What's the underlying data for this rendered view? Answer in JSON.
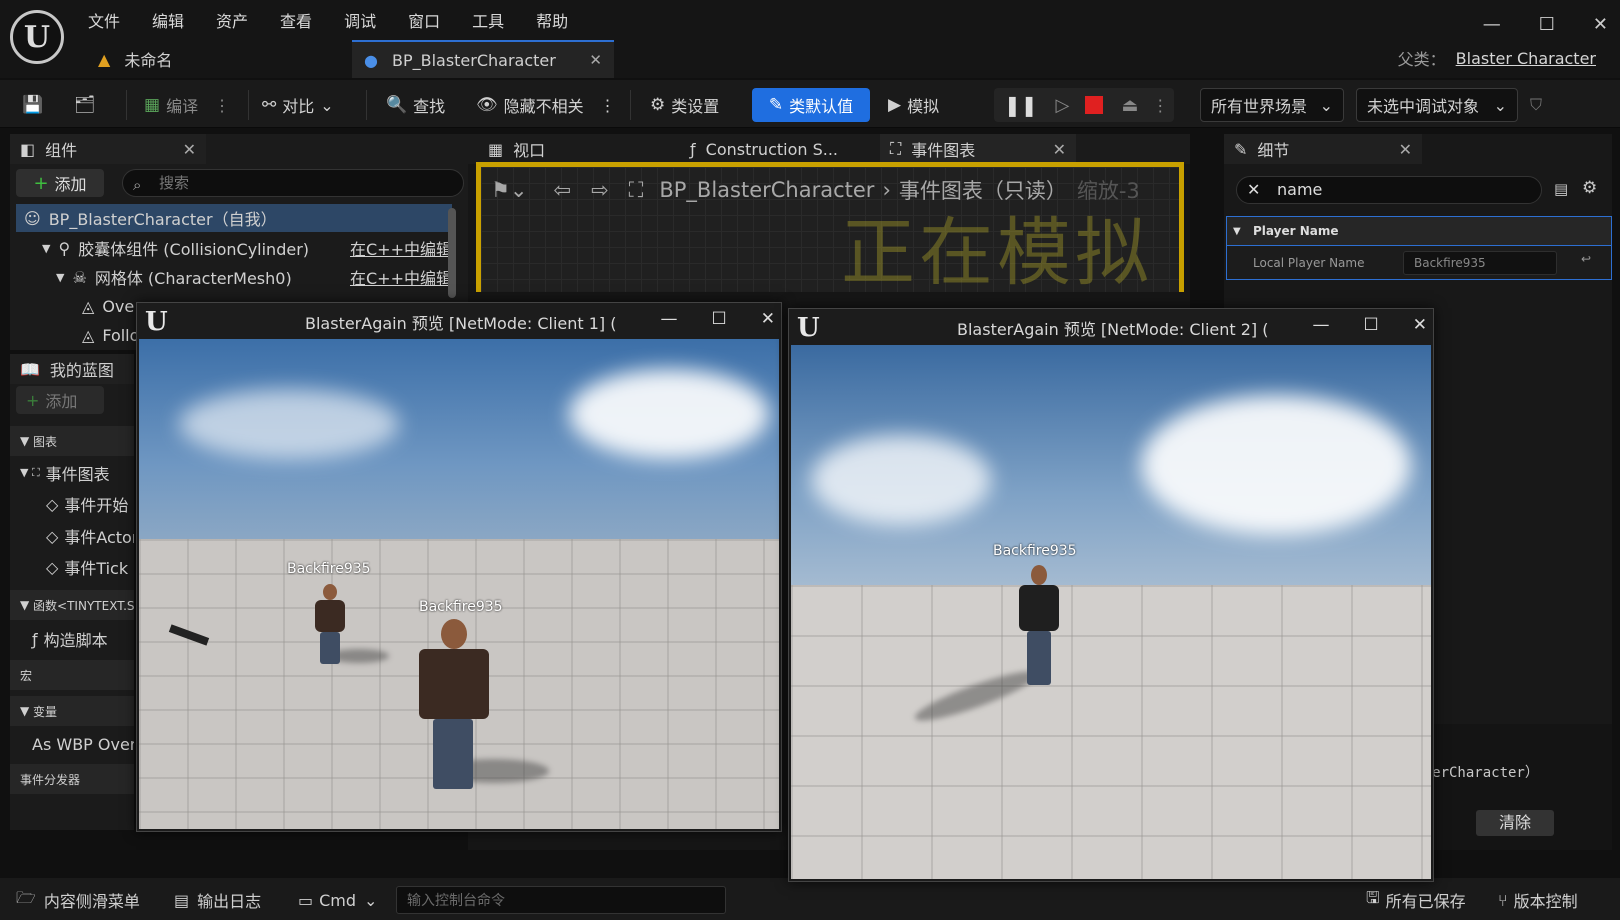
{
  "titlebar": {
    "menu": [
      "文件",
      "编辑",
      "资产",
      "查看",
      "调试",
      "窗口",
      "工具",
      "帮助"
    ],
    "tabs": [
      {
        "label": "未命名"
      },
      {
        "label": "BP_BlasterCharacter"
      }
    ],
    "parent_label": "父类：",
    "parent_value": "Blaster Character"
  },
  "toolbar": {
    "compile": "编译",
    "diff": "对比",
    "find": "查找",
    "hide_unrelated": "隐藏不相关",
    "class_settings": "类设置",
    "class_defaults": "类默认值",
    "simulate": "模拟",
    "world_dropdown": "所有世界场景",
    "debug_dropdown": "未选中调试对象"
  },
  "components": {
    "title": "组件",
    "add": "添加",
    "search_placeholder": "搜索",
    "tree": [
      {
        "label": "BP_BlasterCharacter（自我）",
        "edit": ""
      },
      {
        "label": "胶囊体组件 (CollisionCylinder)",
        "edit": "在C++中编辑"
      },
      {
        "label": "网格体 (CharacterMesh0)",
        "edit": "在C++中编辑"
      },
      {
        "label": "Ove",
        "edit": ""
      },
      {
        "label": "Follo",
        "edit": ""
      }
    ]
  },
  "my_blueprint": {
    "title": "我的蓝图",
    "add": "添加",
    "rows": [
      {
        "label": "图表"
      },
      {
        "label": "事件图表"
      },
      {
        "label": "事件开始"
      },
      {
        "label": "事件Actor"
      },
      {
        "label": "事件Tick"
      },
      {
        "label": "函数<TINYTEXT.S"
      },
      {
        "label": "构造脚本"
      },
      {
        "label": "宏"
      },
      {
        "label": "变量"
      },
      {
        "label": "As WBP Over"
      },
      {
        "label": "事件分发器"
      }
    ]
  },
  "center": {
    "tabs": [
      "视口",
      "Construction S...",
      "事件图表"
    ],
    "breadcrumb_bp": "BP_BlasterCharacter",
    "breadcrumb_graph": "事件图表（只读）",
    "zoom": "缩放-3",
    "watermark": "正在模拟"
  },
  "details": {
    "title": "细节",
    "search_value": "name",
    "category": "Player Name",
    "property_label": "Local Player Name",
    "property_value": "Backfire935",
    "log_text": "BlasterCharacter）",
    "clear": "清除"
  },
  "statusbar": {
    "content_drawer": "内容侧滑菜单",
    "output_log": "输出日志",
    "cmd": "Cmd",
    "console_placeholder": "输入控制台命令",
    "all_saved": "所有已保存",
    "source_control": "版本控制"
  },
  "preview1": {
    "title": "BlasterAgain 预览 [NetMode: Client 1]  (",
    "nametags": [
      "Backfire935",
      "Backfire935"
    ]
  },
  "preview2": {
    "title": "BlasterAgain 预览 [NetMode: Client 2]  (",
    "nametags": [
      "Backfire935"
    ]
  },
  "colors": {
    "accent_blue": "#1f6ee0",
    "stop_red": "#e02020",
    "sim_border": "#c9a100",
    "add_green": "#3fbf3f"
  }
}
